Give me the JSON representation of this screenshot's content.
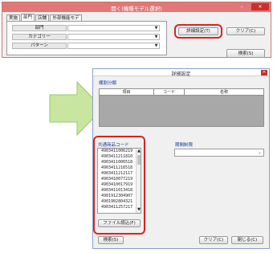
{
  "window_main": {
    "title": "開く(機種モデル選択)",
    "controls": {
      "minimize": "–",
      "close": "✕"
    },
    "tabs": [
      "実施",
      "部門",
      "店舗",
      "外部機能モデル"
    ],
    "active_tab_index": 1,
    "fields": [
      {
        "label": "部門",
        "value": ""
      },
      {
        "label": "カテゴリー",
        "value": ""
      },
      {
        "label": "パターン",
        "value": ""
      }
    ],
    "buttons": {
      "detail": "詳細設定(T)",
      "clear": "クリア(C)",
      "search": "検索(S)"
    }
  },
  "window_detail": {
    "title": "詳細設定",
    "section_product": "棚割分類",
    "table_headers": [
      "項目",
      "コード",
      "名称"
    ],
    "section_jan": "共通商品コード",
    "jan_codes": [
      "4903411006219",
      "4903411211810",
      "4903411006518",
      "4903411216518",
      "4903411212117",
      "4903410077219",
      "4903410017919",
      "4903411013418",
      "4901912304907",
      "4901902804321",
      "4903411257217"
    ],
    "file_button": "ファイル読込(F)",
    "section_period": "期間制限",
    "period_value": "",
    "buttons": {
      "search": "検索(S)",
      "clear": "クリア(C)",
      "close": "閉じる(C)"
    }
  },
  "colors": {
    "highlight": "#e02020",
    "titlebar_main": "#e07878",
    "arrow_fill": "#c8e6a0"
  }
}
